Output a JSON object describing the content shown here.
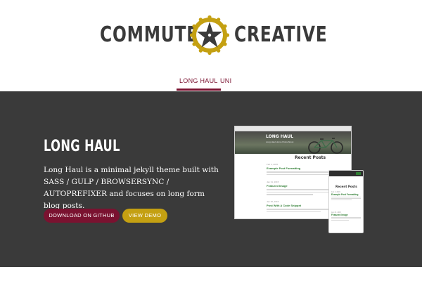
{
  "brand": {
    "name_left": "COMMUTER",
    "name_right": "CREATIVE",
    "badge_icon": "star-gear-icon",
    "colors": {
      "badge": "#c4a012",
      "star": "#3a3a3a"
    }
  },
  "nav": {
    "items": [
      {
        "label": "LONG HAUL",
        "active": true
      },
      {
        "label": "UNI",
        "active": false
      }
    ],
    "accent_color": "#7a1230"
  },
  "hero": {
    "title": "LONG HAUL",
    "description": "Long Haul is a minimal jekyll theme built with SASS / GULP / BROWSERSYNC / AUTOPREFIXER and focuses on long form blog posts.",
    "background_color": "#3a3a3a",
    "buttons": {
      "github_label": "DOWNLOAD ON GITHUB",
      "demo_label": "VIEW DEMO",
      "github_color": "#7a1230",
      "demo_color": "#c4a012"
    }
  },
  "preview": {
    "desktop": {
      "site_title": "LONG HAUL",
      "nav_links": "Long Haul   Home   Posts   About",
      "section_title": "Recent Posts",
      "posts": [
        {
          "date": "Feb 3, 2015",
          "title": "Example Post Formatting"
        },
        {
          "date": "Jan 31, 2015",
          "title": "Featured Image"
        },
        {
          "date": "Jan 30, 2015",
          "title": "Post With A Code Snippet"
        }
      ]
    },
    "mobile": {
      "section_title": "Recent Posts",
      "posts": [
        {
          "date": "Feb 3, 2015",
          "title": "Example Post Formatting"
        },
        {
          "date": "Jan 31, 2015",
          "title": "Featured Image"
        }
      ]
    }
  }
}
